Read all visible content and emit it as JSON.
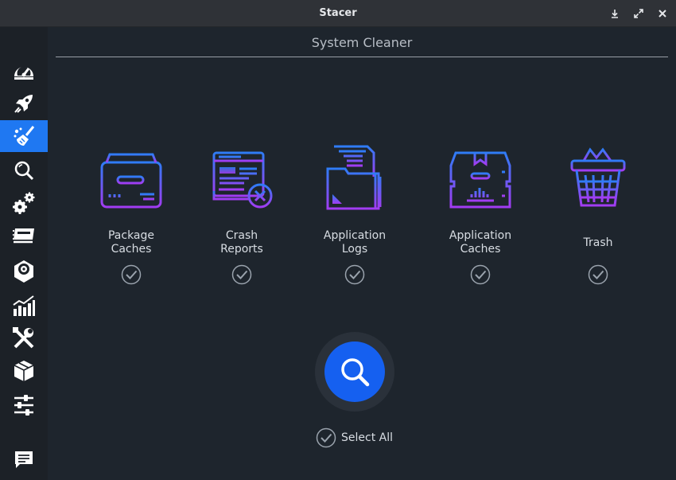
{
  "window": {
    "title": "Stacer"
  },
  "page": {
    "title": "System Cleaner"
  },
  "sidebar": {
    "items": [
      {
        "name": "dashboard",
        "icon": "speedometer-icon"
      },
      {
        "name": "startup-apps",
        "icon": "rocket-icon"
      },
      {
        "name": "system-cleaner",
        "icon": "broom-icon",
        "active": true
      },
      {
        "name": "search",
        "icon": "search-icon"
      },
      {
        "name": "services",
        "icon": "gears-icon"
      },
      {
        "name": "processes",
        "icon": "processes-icon"
      },
      {
        "name": "uninstaller",
        "icon": "disk-icon"
      },
      {
        "name": "resources",
        "icon": "chart-icon"
      },
      {
        "name": "helpers",
        "icon": "tools-icon"
      },
      {
        "name": "apt-repository-manager",
        "icon": "package-icon"
      },
      {
        "name": "settings",
        "icon": "sliders-icon"
      },
      {
        "name": "feedback",
        "icon": "chat-icon"
      }
    ]
  },
  "categories": [
    {
      "label": "Package\nCaches",
      "icon": "package-cache-icon",
      "checked": true
    },
    {
      "label": "Crash\nReports",
      "icon": "crash-report-icon",
      "checked": true
    },
    {
      "label": "Application\nLogs",
      "icon": "logs-folder-icon",
      "checked": true
    },
    {
      "label": "Application\nCaches",
      "icon": "app-cache-icon",
      "checked": true
    },
    {
      "label": "Trash",
      "icon": "trash-basket-icon",
      "checked": true
    }
  ],
  "select_all": {
    "label": "Select All",
    "checked": true
  },
  "colors": {
    "accent": "#1f78f2",
    "search_button": "#1560f0",
    "icon_gradient_top": "#2f7cf6",
    "icon_gradient_bottom": "#a23cf2"
  }
}
